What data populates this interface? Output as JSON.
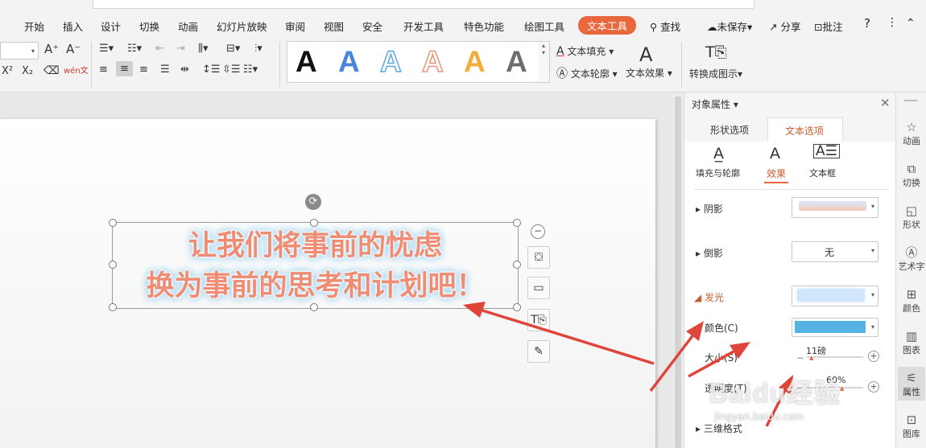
{
  "menu": {
    "items": [
      "开始",
      "插入",
      "设计",
      "切换",
      "动画",
      "幻灯片放映",
      "审阅",
      "视图",
      "安全",
      "开发工具",
      "特色功能",
      "绘图工具",
      "文本工具"
    ],
    "active": "文本工具",
    "search": "查找",
    "save_status": "未保存",
    "share": "分享",
    "comment": "批注",
    "help": "?",
    "more": "⋮",
    "collapse": "⌃"
  },
  "ribbon": {
    "grow_font": "A⁺",
    "shrink_font": "A⁻",
    "superscript": "X²",
    "subscript": "X₂",
    "clear_format": "⌫",
    "pinyin": "wén文",
    "gallery": [
      {
        "letter": "A",
        "color": "#111111",
        "style": "solid"
      },
      {
        "letter": "A",
        "color": "#4a86d8",
        "style": "solid"
      },
      {
        "letter": "A",
        "color": "#5aa6dd",
        "style": "outline"
      },
      {
        "letter": "A",
        "color": "#e9947a",
        "style": "outline"
      },
      {
        "letter": "A",
        "color": "#f1ad3a",
        "style": "solid"
      },
      {
        "letter": "A",
        "color": "#555555",
        "style": "gradient"
      }
    ],
    "text_fill": "文本填充",
    "text_outline": "文本轮廓",
    "text_effect": "文本效果",
    "convert_to_diagram": "转换成图示"
  },
  "slide": {
    "line1": "让我们将事前的忧虑",
    "line2": "换为事前的思考和计划吧！",
    "text_color": "#ee8d73",
    "glow_color": "#9cd1ee"
  },
  "pane": {
    "title": "对象属性",
    "tabs": [
      "形状选项",
      "文本选项"
    ],
    "active_tab": "文本选项",
    "subtabs": [
      "填充与轮廓",
      "效果",
      "文本框"
    ],
    "active_subtab": "效果",
    "shadow_label": "阴影",
    "reflection_label": "倒影",
    "reflection_value": "无",
    "glow_label": "发光",
    "color_label": "颜色(C)",
    "color_value": "#55b3e3",
    "size_label": "大小(S)",
    "size_value": "11磅",
    "transparency_label": "透明度(T)",
    "transparency_value": "60%",
    "threed_label": "三维格式"
  },
  "rightbar": {
    "items": [
      "动画",
      "切换",
      "形状",
      "艺术字",
      "颜色",
      "图表",
      "属性",
      "图库"
    ],
    "active": "属性"
  },
  "watermark": {
    "logo": "Baidu经验",
    "url": "jingyan.baidu.com"
  }
}
